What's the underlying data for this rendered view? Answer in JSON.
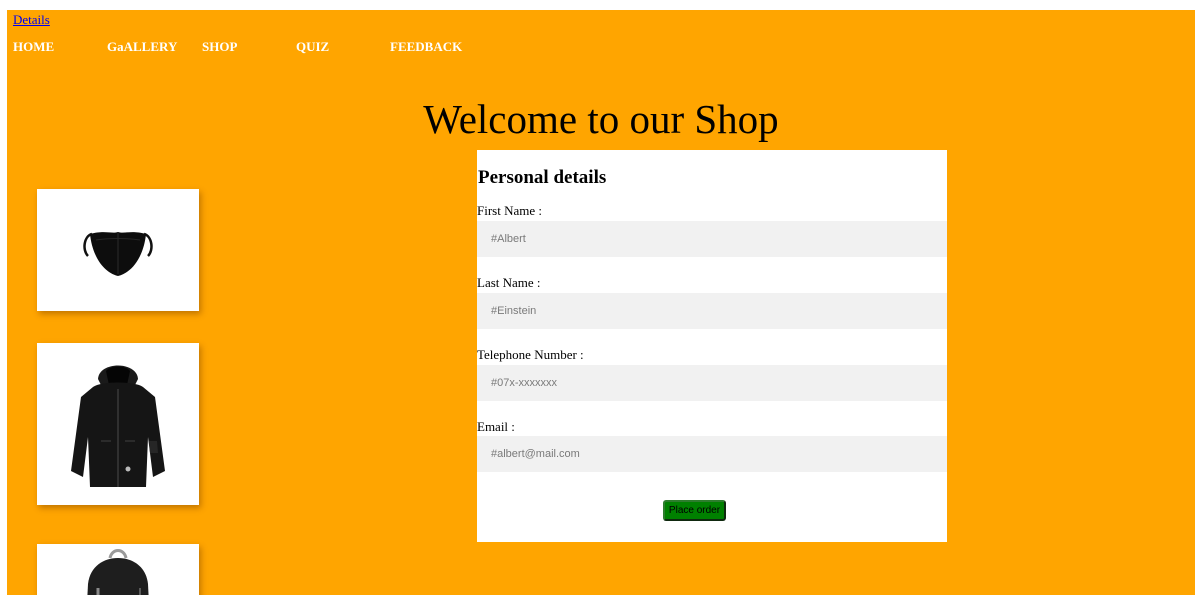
{
  "top_link": "Details",
  "nav": {
    "items": [
      {
        "label": "HOME"
      },
      {
        "label": "GaALLERY"
      },
      {
        "label": "SHOP"
      },
      {
        "label": "QUIZ"
      },
      {
        "label": "FEEDBACK"
      }
    ]
  },
  "main": {
    "title": "Welcome to our Shop"
  },
  "form": {
    "heading": "Personal details",
    "fields": [
      {
        "label": "First Name :",
        "placeholder": "#Albert"
      },
      {
        "label": "Last Name :",
        "placeholder": "#Einstein"
      },
      {
        "label": "Telephone Number :",
        "placeholder": "#07x-xxxxxxx"
      },
      {
        "label": "Email :",
        "placeholder": "#albert@mail.com"
      }
    ],
    "submit_label": "Place order"
  },
  "products": [
    {
      "icon": "face-mask-icon"
    },
    {
      "icon": "black-jacket-icon"
    },
    {
      "icon": "backpack-icon"
    }
  ],
  "colors": {
    "page_background": "#ffa500",
    "nav_text": "#ffffff",
    "link": "#0000ee",
    "input_background": "#f1f1f1",
    "button_background": "#008000"
  }
}
